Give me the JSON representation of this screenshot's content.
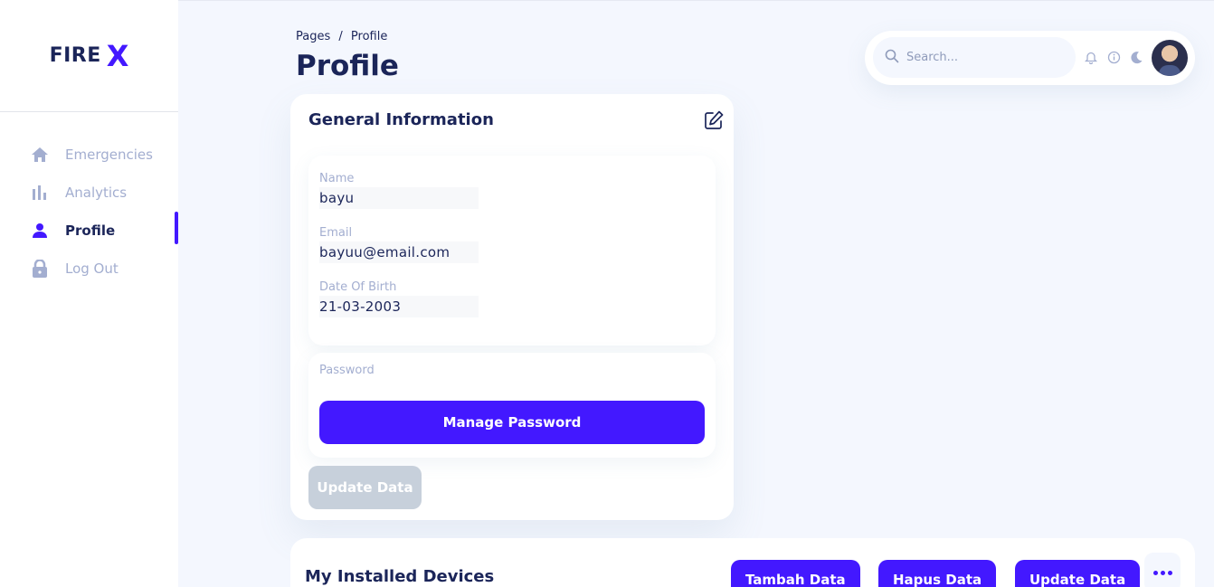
{
  "colors": {
    "accent": "#4318ff",
    "text_primary": "#1b2559",
    "text_muted": "#a3aed0",
    "background": "#f4f7fe",
    "disabled_button": "#c7d0db"
  },
  "sidebar": {
    "logo_text": "FIRE",
    "logo_mark": "X",
    "items": [
      {
        "label": "Emergencies",
        "icon": "home-icon",
        "active": false
      },
      {
        "label": "Analytics",
        "icon": "bar-chart-icon",
        "active": false
      },
      {
        "label": "Profile",
        "icon": "user-icon",
        "active": true
      },
      {
        "label": "Log Out",
        "icon": "lock-icon",
        "active": false
      }
    ]
  },
  "header": {
    "breadcrumb": {
      "parent": "Pages",
      "separator": "/",
      "current": "Profile"
    },
    "title": "Profile",
    "search": {
      "placeholder": "Search...",
      "value": ""
    },
    "icons": [
      "bell-icon",
      "info-icon",
      "moon-icon",
      "avatar"
    ]
  },
  "general_info": {
    "title": "General Information",
    "fields": [
      {
        "label": "Name",
        "value": "bayu"
      },
      {
        "label": "Email",
        "value": "bayuu@email.com"
      },
      {
        "label": "Date Of Birth",
        "value": "21-03-2003"
      }
    ],
    "password_label": "Password",
    "manage_password_label": "Manage Password",
    "update_label": "Update Data"
  },
  "devices": {
    "title": "My Installed Devices",
    "buttons": [
      "Tambah Data",
      "Hapus Data",
      "Update Data"
    ]
  }
}
